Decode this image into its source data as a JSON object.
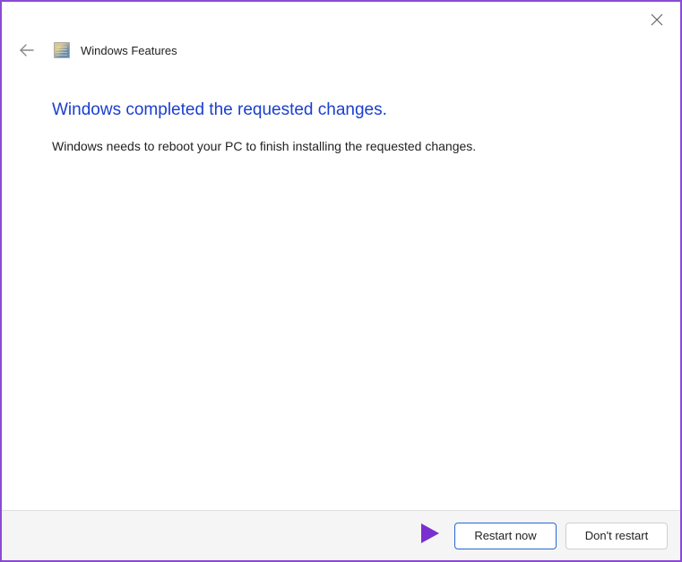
{
  "window": {
    "title": "Windows Features"
  },
  "content": {
    "heading": "Windows completed the requested changes.",
    "body": "Windows needs to reboot your PC to finish installing the requested changes."
  },
  "footer": {
    "restart_label": "Restart now",
    "dont_restart_label": "Don't restart"
  }
}
